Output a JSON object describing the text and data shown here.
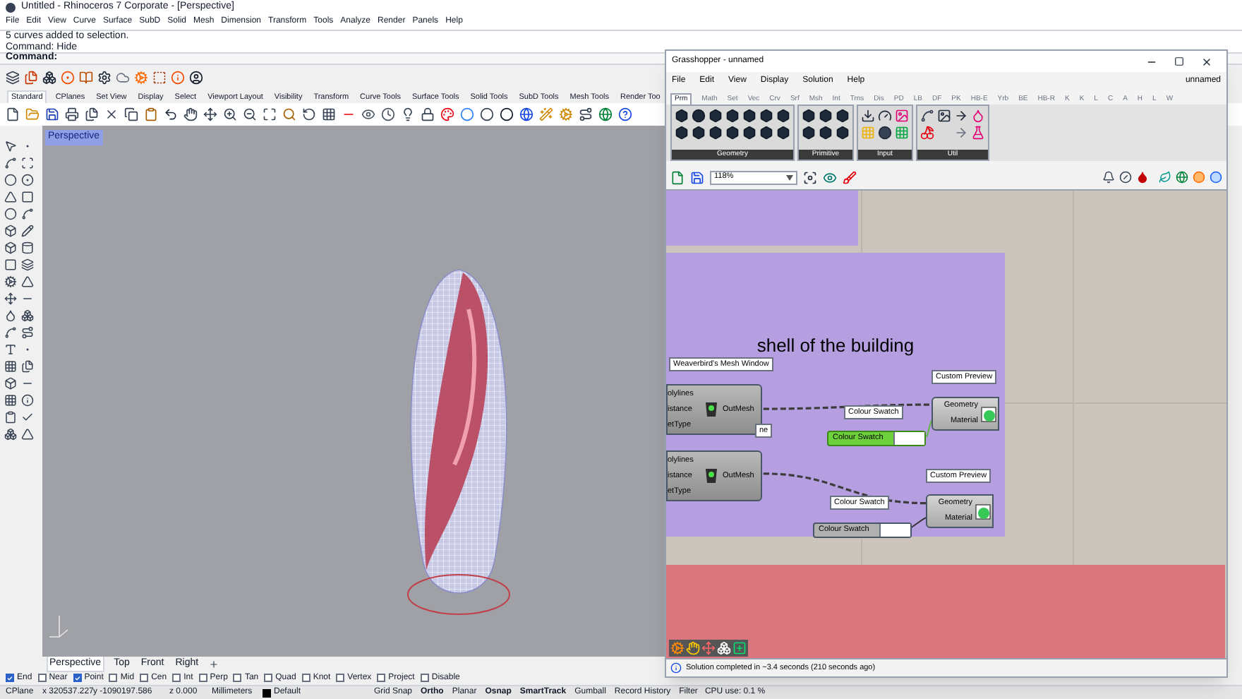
{
  "rhino": {
    "title": "Untitled - Rhinoceros 7 Corporate - [Perspective]",
    "menu": [
      "File",
      "Edit",
      "View",
      "Curve",
      "Surface",
      "SubD",
      "Solid",
      "Mesh",
      "Dimension",
      "Transform",
      "Tools",
      "Analyze",
      "Render",
      "Panels",
      "Help"
    ],
    "command_history": [
      "5 curves added to selection.",
      "Command: Hide"
    ],
    "command_prompt": "Command:",
    "toolbar_tabs": [
      {
        "label": "Standard",
        "selected": true
      },
      {
        "label": "CPlanes",
        "selected": false
      },
      {
        "label": "Set View",
        "selected": false
      },
      {
        "label": "Display",
        "selected": false
      },
      {
        "label": "Select",
        "selected": false
      },
      {
        "label": "Viewport Layout",
        "selected": false
      },
      {
        "label": "Visibility",
        "selected": false
      },
      {
        "label": "Transform",
        "selected": false
      },
      {
        "label": "Curve Tools",
        "selected": false
      },
      {
        "label": "Surface Tools",
        "selected": false
      },
      {
        "label": "Solid Tools",
        "selected": false
      },
      {
        "label": "SubD Tools",
        "selected": false
      },
      {
        "label": "Mesh Tools",
        "selected": false
      },
      {
        "label": "Render Too",
        "selected": false
      }
    ],
    "viewport": {
      "label": "Perspective"
    },
    "viewport_tabs": [
      {
        "label": "Perspective",
        "selected": true
      },
      {
        "label": "Top",
        "selected": false
      },
      {
        "label": "Front",
        "selected": false
      },
      {
        "label": "Right",
        "selected": false
      }
    ],
    "osnaps": [
      {
        "label": "End",
        "checked": true
      },
      {
        "label": "Near",
        "checked": false
      },
      {
        "label": "Point",
        "checked": true
      },
      {
        "label": "Mid",
        "checked": false
      },
      {
        "label": "Cen",
        "checked": false
      },
      {
        "label": "Int",
        "checked": false
      },
      {
        "label": "Perp",
        "checked": false
      },
      {
        "label": "Tan",
        "checked": false
      },
      {
        "label": "Quad",
        "checked": false
      },
      {
        "label": "Knot",
        "checked": false
      },
      {
        "label": "Vertex",
        "checked": false
      },
      {
        "label": "Project",
        "checked": false
      },
      {
        "label": "Disable",
        "checked": false
      }
    ],
    "status_bar": {
      "cplane": "CPlane",
      "x": "x 320537.227",
      "y": "y -1090197.586",
      "z": "z 0.000",
      "units": "Millimeters",
      "layer": "Default",
      "toggles": [
        {
          "label": "Grid Snap",
          "on": false
        },
        {
          "label": "Ortho",
          "on": true
        },
        {
          "label": "Planar",
          "on": false
        },
        {
          "label": "Osnap",
          "on": true
        },
        {
          "label": "SmartTrack",
          "on": true
        },
        {
          "label": "Gumball",
          "on": false
        },
        {
          "label": "Record History",
          "on": false
        },
        {
          "label": "Filter",
          "on": false
        }
      ],
      "cpu": "CPU use: 0.1 %"
    }
  },
  "grasshopper": {
    "title": "Grasshopper - unnamed",
    "menu": [
      "File",
      "Edit",
      "View",
      "Display",
      "Solution",
      "Help"
    ],
    "document": "unnamed",
    "tabs": [
      {
        "label": "Prm",
        "selected": true
      },
      {
        "label": "Math",
        "selected": false
      },
      {
        "label": "Set",
        "selected": false
      },
      {
        "label": "Vec",
        "selected": false
      },
      {
        "label": "Crv",
        "selected": false
      },
      {
        "label": "Srf",
        "selected": false
      },
      {
        "label": "Msh",
        "selected": false
      },
      {
        "label": "Int",
        "selected": false
      },
      {
        "label": "Trns",
        "selected": false
      },
      {
        "label": "Dis",
        "selected": false
      },
      {
        "label": "PD",
        "selected": false
      },
      {
        "label": "LB",
        "selected": false
      },
      {
        "label": "DF",
        "selected": false
      },
      {
        "label": "PK",
        "selected": false
      },
      {
        "label": "HB-E",
        "selected": false
      },
      {
        "label": "Yrb",
        "selected": false
      },
      {
        "label": "BE",
        "selected": false
      },
      {
        "label": "HB-R",
        "selected": false
      },
      {
        "label": "K",
        "selected": false
      },
      {
        "label": "K",
        "selected": false
      },
      {
        "label": "L",
        "selected": false
      },
      {
        "label": "C",
        "selected": false
      },
      {
        "label": "A",
        "selected": false
      },
      {
        "label": "H",
        "selected": false
      },
      {
        "label": "L",
        "selected": false
      },
      {
        "label": "W",
        "selected": false
      }
    ],
    "ribbon_panels": [
      "Geometry",
      "Primitive",
      "Input",
      "Util"
    ],
    "zoom": "118%",
    "canvas": {
      "groups": [
        {
          "color": "#b59fe0"
        },
        {
          "title": "shell of the building",
          "color": "#b59fe0"
        },
        {
          "color": "#d9767e"
        }
      ],
      "labels": [
        "Weaverbird's Mesh Window",
        "ne",
        "Custom Preview",
        "Colour Swatch",
        "Custom Preview",
        "Colour Swatch"
      ],
      "mesh_components": [
        {
          "inputs": [
            "olylines",
            "istance",
            "etType"
          ],
          "output": "OutMesh"
        },
        {
          "inputs": [
            "olylines",
            "istance",
            "etType"
          ],
          "output": "OutMesh"
        }
      ],
      "preview_components": [
        {
          "inputs": [
            "Geometry",
            "Material"
          ]
        },
        {
          "inputs": [
            "Geometry",
            "Material"
          ]
        }
      ],
      "swatches": [
        {
          "label": "Colour Swatch",
          "selected": true
        },
        {
          "label": "Colour Swatch",
          "selected": false
        }
      ]
    },
    "status": "Solution completed in ~3.4 seconds (210 seconds ago)"
  }
}
